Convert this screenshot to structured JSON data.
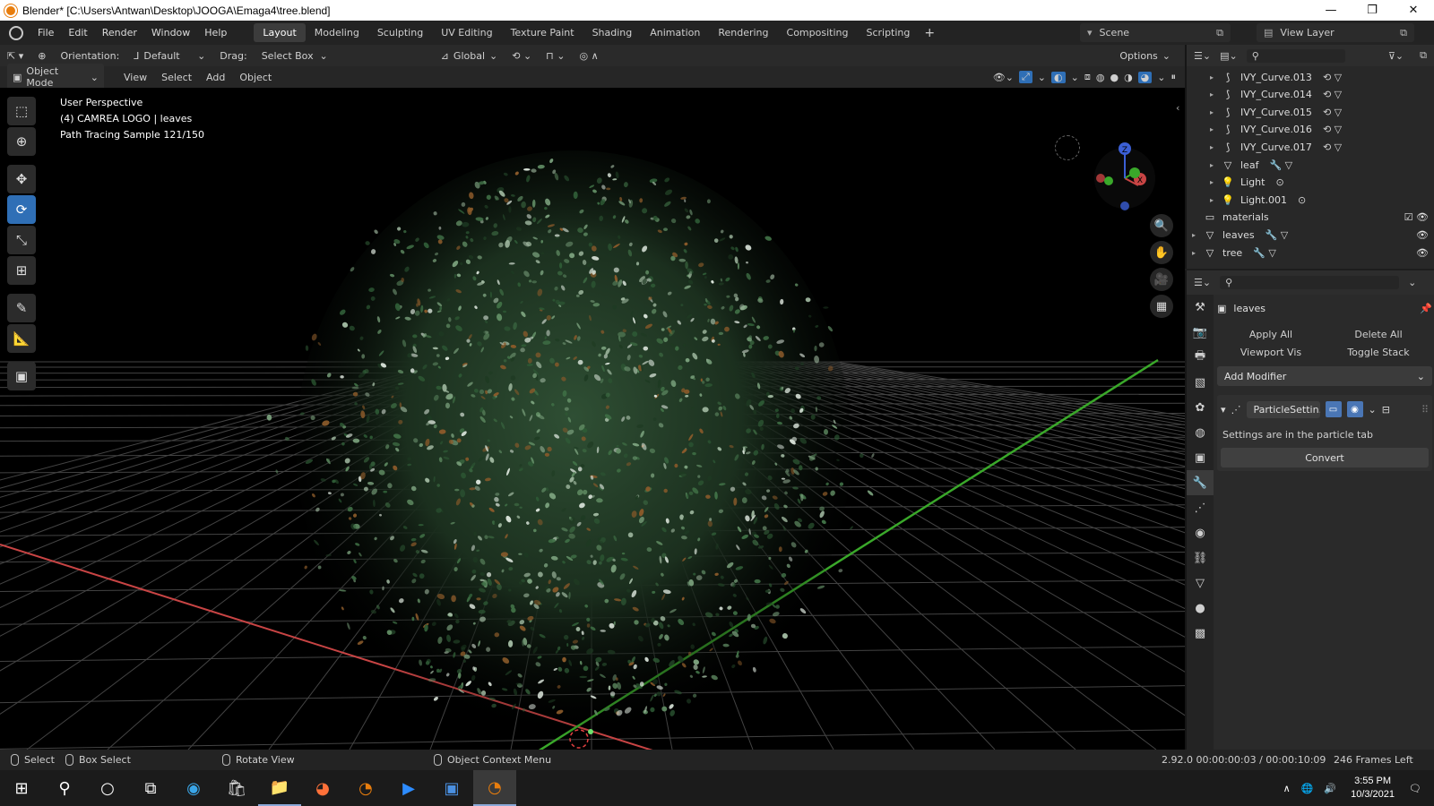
{
  "window": {
    "title": "Blender* [C:\\Users\\Antwan\\Desktop\\JOOGA\\Emaga4\\tree.blend]",
    "controls": [
      "—",
      "❐",
      "✕"
    ]
  },
  "menu": {
    "items": [
      "File",
      "Edit",
      "Render",
      "Window",
      "Help"
    ],
    "workspaces": [
      "Layout",
      "Modeling",
      "Sculpting",
      "UV Editing",
      "Texture Paint",
      "Shading",
      "Animation",
      "Rendering",
      "Compositing",
      "Scripting"
    ],
    "active_workspace": "Layout",
    "scene": "Scene",
    "view_layer": "View Layer"
  },
  "tool_header": {
    "orientation_label": "Orientation:",
    "orientation_value": "Default",
    "drag_label": "Drag:",
    "drag_value": "Select Box",
    "transform_orientation": "Global",
    "options": "Options"
  },
  "viewport_header": {
    "mode": "Object Mode",
    "menus": [
      "View",
      "Select",
      "Add",
      "Object"
    ]
  },
  "viewport_overlay": {
    "perspective": "User Perspective",
    "collection": "(4) CAMREA LOGO | leaves",
    "render_status": "Path Tracing Sample 121/150"
  },
  "gizmo": {
    "x": "X",
    "y": "Y",
    "z": "Z"
  },
  "outliner": {
    "rows": [
      {
        "label": "IVY_Curve.013",
        "type": "curve"
      },
      {
        "label": "IVY_Curve.014",
        "type": "curve"
      },
      {
        "label": "IVY_Curve.015",
        "type": "curve"
      },
      {
        "label": "IVY_Curve.016",
        "type": "curve"
      },
      {
        "label": "IVY_Curve.017",
        "type": "curve"
      },
      {
        "label": "leaf",
        "type": "mesh"
      },
      {
        "label": "Light",
        "type": "light"
      },
      {
        "label": "Light.001",
        "type": "light"
      },
      {
        "label": "materials",
        "type": "collection"
      },
      {
        "label": "leaves",
        "type": "mesh"
      },
      {
        "label": "tree",
        "type": "mesh"
      }
    ]
  },
  "properties": {
    "object_name": "leaves",
    "apply_all": "Apply All",
    "delete_all": "Delete All",
    "viewport_vis": "Viewport Vis",
    "toggle_stack": "Toggle Stack",
    "add_modifier": "Add Modifier",
    "modifier_name": "ParticleSettin...",
    "modifier_note": "Settings are in the particle tab",
    "convert": "Convert"
  },
  "statusbar": {
    "select": "Select",
    "box_select": "Box Select",
    "rotate_view": "Rotate View",
    "context_menu": "Object Context Menu",
    "version_time": "2.92.0  00:00:00:03 / 00:00:10:09",
    "frames_left": "246 Frames Left"
  },
  "taskbar": {
    "time": "3:55 PM",
    "date": "10/3/2021"
  },
  "colors": {
    "x_axis": "#c84444",
    "y_axis": "#3aa82a",
    "z_axis": "#3b5fd6",
    "active_tab": "#3c3c3c",
    "selection_blue": "#2f6fb6",
    "foliage_dark": "#1f3a22",
    "foliage_light": "#6a8f6a"
  }
}
